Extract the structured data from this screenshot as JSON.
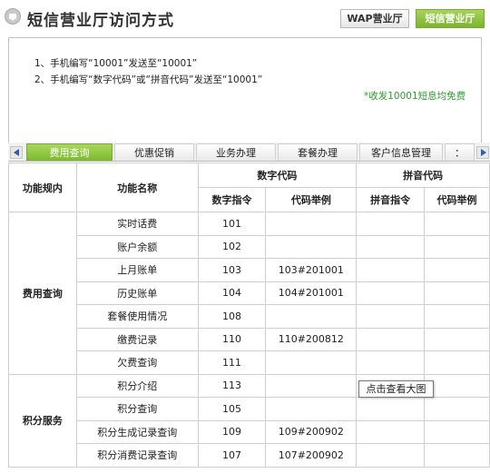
{
  "header": {
    "title": "短信营业厅访问方式",
    "wap_button": "WAP营业厅",
    "sms_button": "短信营业厅"
  },
  "info": {
    "line1": "1、手机编写“10001”发送至“10001”",
    "line2": "2、手机编写“数字代码”或“拼音代码”发送至“10001”",
    "note": "*收发10001短息均免费"
  },
  "tabs": [
    {
      "label": "费用查询",
      "active": true
    },
    {
      "label": "优惠促销",
      "active": false
    },
    {
      "label": "业务办理",
      "active": false
    },
    {
      "label": "套餐办理",
      "active": false
    },
    {
      "label": "客户信息管理",
      "active": false
    },
    {
      "label": "：",
      "active": false
    }
  ],
  "table": {
    "headers": {
      "scope": "功能规内",
      "name": "功能名称",
      "digit_code": "数字代码",
      "pinyin_code": "拼音代码",
      "digit_cmd": "数字指令",
      "digit_example": "代码举例",
      "pinyin_cmd": "拼音指令",
      "pinyin_example": "代码举例"
    },
    "groups": [
      {
        "label": "费用查询",
        "rows": [
          {
            "name": "实时话费",
            "digit": "101",
            "example": ""
          },
          {
            "name": "账户余额",
            "digit": "102",
            "example": ""
          },
          {
            "name": "上月账单",
            "digit": "103",
            "example": "103#201001"
          },
          {
            "name": "历史账单",
            "digit": "104",
            "example": "104#201001"
          },
          {
            "name": "套餐使用情况",
            "digit": "108",
            "example": ""
          },
          {
            "name": "缴费记录",
            "digit": "110",
            "example": "110#200812"
          },
          {
            "name": "欠费查询",
            "digit": "111",
            "example": ""
          }
        ]
      },
      {
        "label": "积分服务",
        "rows": [
          {
            "name": "积分介绍",
            "digit": "113",
            "example": ""
          },
          {
            "name": "积分查询",
            "digit": "105",
            "example": ""
          },
          {
            "name": "积分生成记录查询",
            "digit": "109",
            "example": "109#200902"
          },
          {
            "name": "积分消费记录查询",
            "digit": "107",
            "example": "107#200902"
          }
        ]
      }
    ]
  },
  "tooltip": "点击查看大图"
}
